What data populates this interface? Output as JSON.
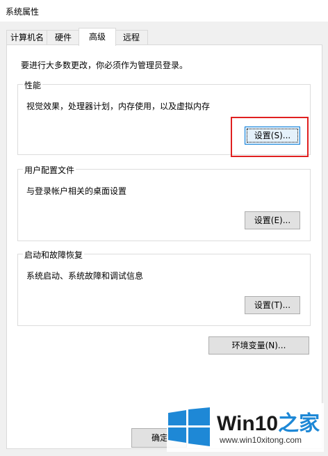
{
  "window": {
    "title": "系统属性"
  },
  "tabs": [
    {
      "label": "计算机名"
    },
    {
      "label": "硬件"
    },
    {
      "label": "高级"
    },
    {
      "label": "远程"
    }
  ],
  "intro": "要进行大多数更改，你必须作为管理员登录。",
  "performance": {
    "title": "性能",
    "desc": "视觉效果，处理器计划，内存使用，以及虚拟内存",
    "button": "设置(S)..."
  },
  "profiles": {
    "title": "用户配置文件",
    "desc": "与登录帐户相关的桌面设置",
    "button": "设置(E)..."
  },
  "startup": {
    "title": "启动和故障恢复",
    "desc": "系统启动、系统故障和调试信息",
    "button": "设置(T)..."
  },
  "env_button": "环境变量(N)...",
  "footer": {
    "ok_partial": "确定"
  },
  "watermark": {
    "brand": "Win10",
    "accent": "之家",
    "url": "www.win10xitong.com"
  },
  "colors": {
    "highlight": "#e02020",
    "focus": "#0078d7",
    "logo_blue": "#1e88d6"
  }
}
